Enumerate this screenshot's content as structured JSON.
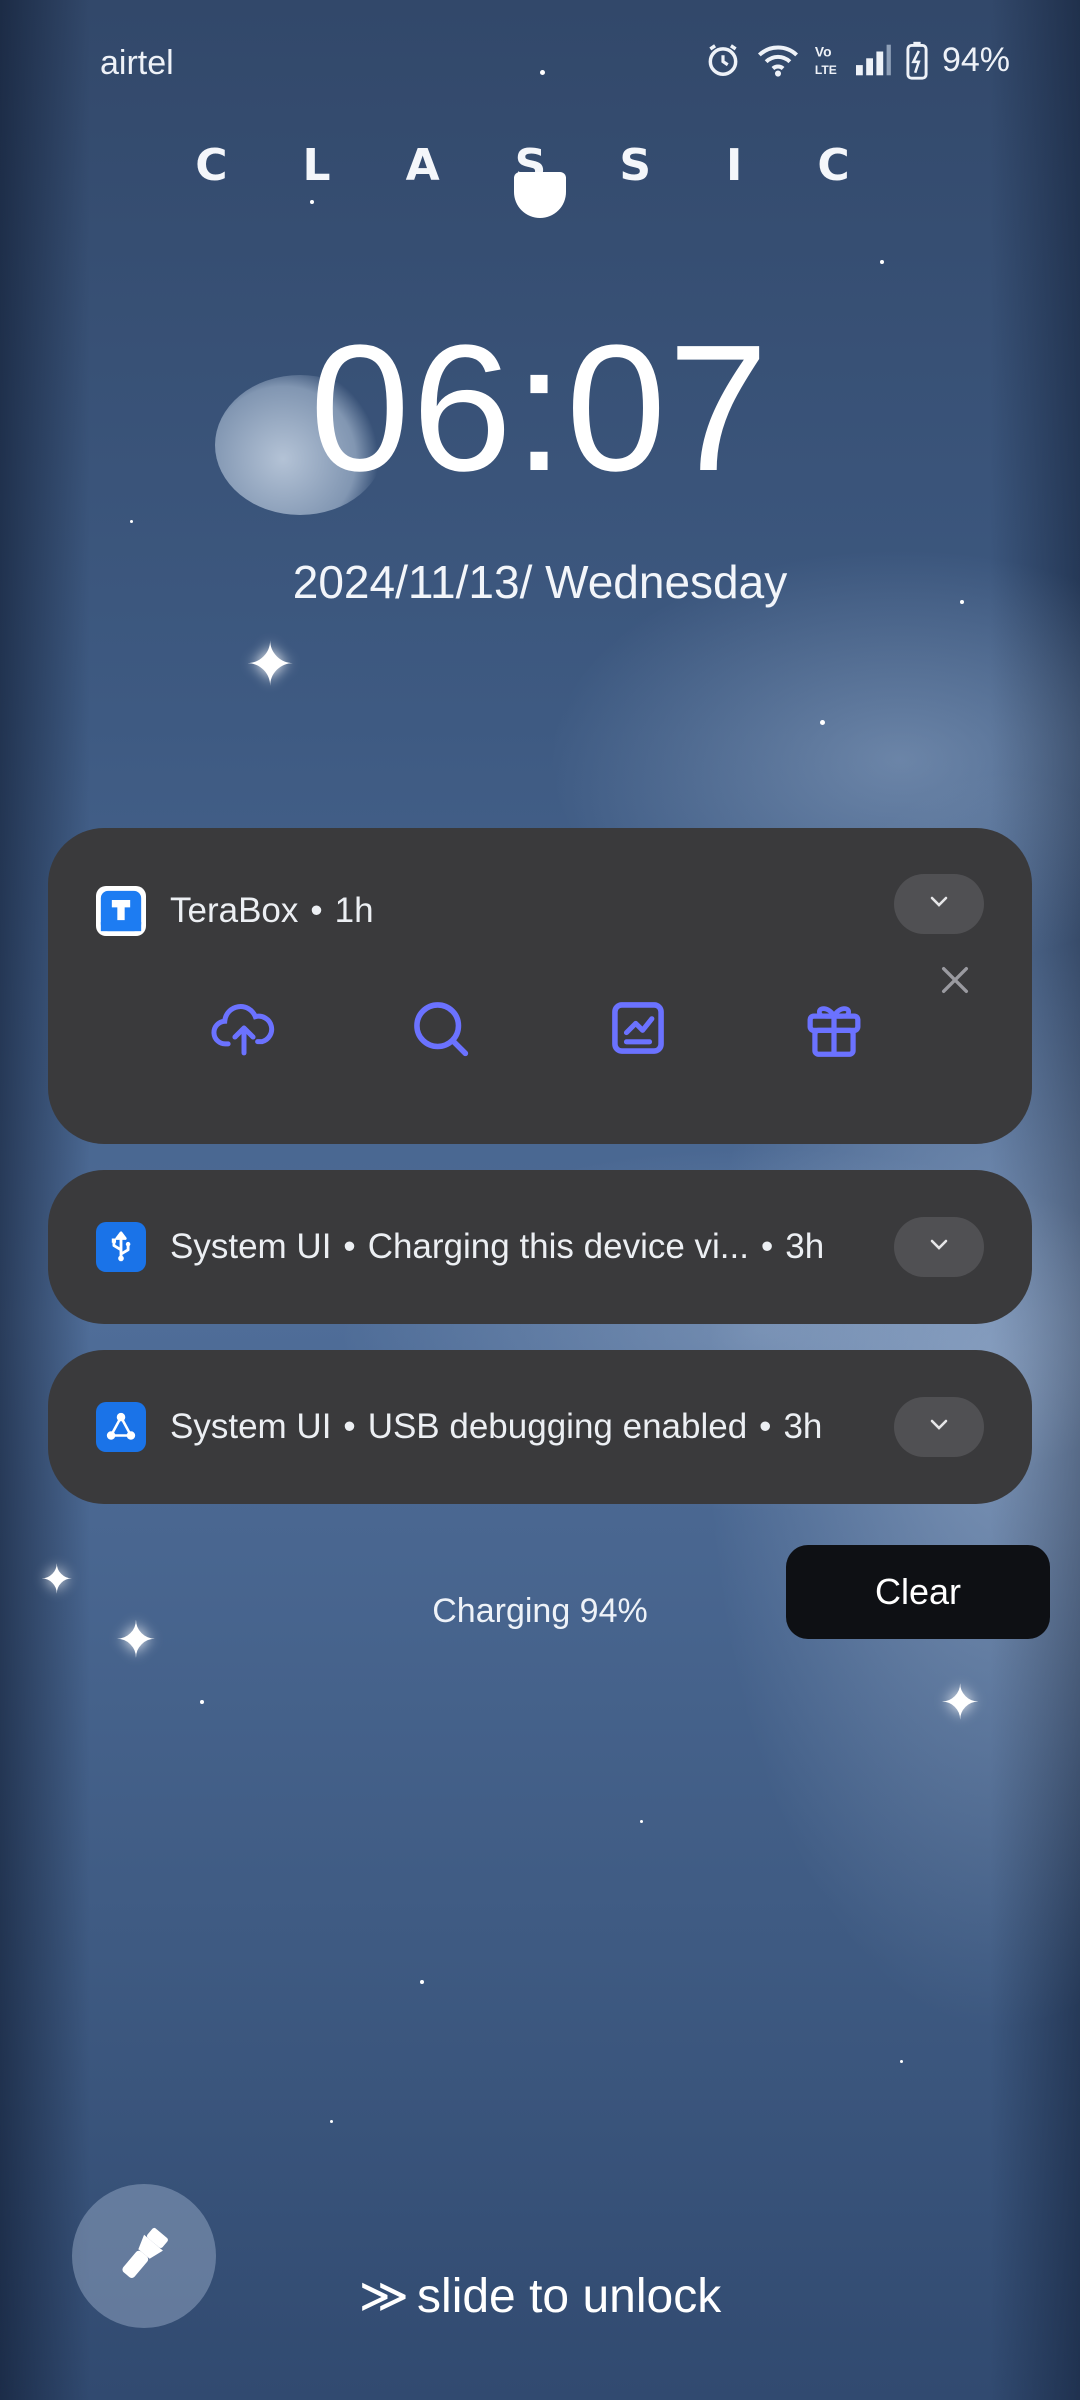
{
  "status_bar": {
    "carrier": "airtel",
    "battery": "94%",
    "icons": [
      "alarm-icon",
      "wifi-icon",
      "volte-icon",
      "signal-icon",
      "battery-icon"
    ]
  },
  "lockscreen": {
    "brand": "CLASSIC",
    "time": "06:07",
    "date": "2024/11/13/ Wednesday"
  },
  "notifications": [
    {
      "app": "TeraBox",
      "time": "1h",
      "actions": [
        "upload-cloud-icon",
        "search-icon",
        "chart-icon",
        "gift-icon"
      ]
    },
    {
      "app": "System UI",
      "message": "Charging this device vi...",
      "time": "3h",
      "icon": "usb-icon"
    },
    {
      "app": "System UI",
      "message": "USB debugging enabled",
      "time": "3h",
      "icon": "debug-icon"
    }
  ],
  "charging_text": "Charging 94%",
  "clear_label": "Clear",
  "unlock": {
    "arrows": "≫",
    "text": "slide to unlock"
  },
  "colors": {
    "card_bg": "#3a3a3c",
    "accent": "#6b72ff",
    "system_icon_blue": "#1a73e8"
  }
}
